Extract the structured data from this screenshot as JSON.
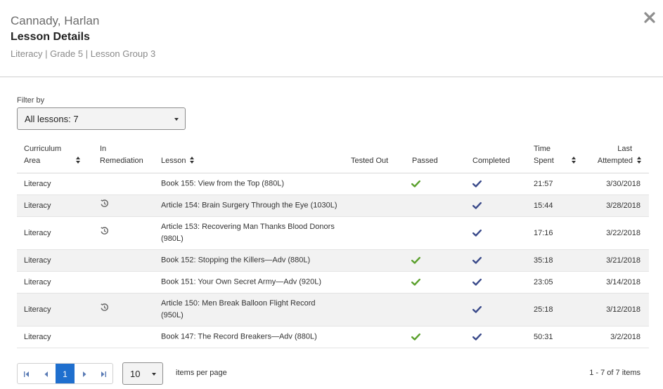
{
  "header": {
    "student_name": "Cannady, Harlan",
    "title": "Lesson Details",
    "breadcrumb": "Literacy | Grade 5 | Lesson Group 3",
    "close_icon": "close-icon"
  },
  "filter": {
    "label": "Filter by",
    "selected": "All lessons: 7"
  },
  "table": {
    "columns": {
      "curriculum_area": "Curriculum Area",
      "curriculum_area_l1": "Curriculum",
      "curriculum_area_l2": "Area",
      "in_remediation_l1": "In",
      "in_remediation_l2": "Remediation",
      "lesson": "Lesson",
      "tested_out": "Tested Out",
      "passed": "Passed",
      "completed": "Completed",
      "time_spent_l1": "Time",
      "time_spent_l2": "Spent",
      "last_attempted_l1": "Last",
      "last_attempted_l2": "Attempted"
    },
    "rows": [
      {
        "area": "Literacy",
        "remediation": false,
        "lesson_l1": "Book 155: View from the Top (880L)",
        "lesson_l2": "",
        "passed": true,
        "completed": true,
        "time": "21:57",
        "last": "3/30/2018"
      },
      {
        "area": "Literacy",
        "remediation": true,
        "lesson_l1": "Article 154: Brain Surgery Through the Eye (1030L)",
        "lesson_l2": "",
        "passed": false,
        "completed": true,
        "time": "15:44",
        "last": "3/28/2018"
      },
      {
        "area": "Literacy",
        "remediation": true,
        "lesson_l1": "Article 153: Recovering Man Thanks Blood Donors",
        "lesson_l2": "(980L)",
        "passed": false,
        "completed": true,
        "time": "17:16",
        "last": "3/22/2018"
      },
      {
        "area": "Literacy",
        "remediation": false,
        "lesson_l1": "Book 152: Stopping the Killers—Adv (880L)",
        "lesson_l2": "",
        "passed": true,
        "completed": true,
        "time": "35:18",
        "last": "3/21/2018"
      },
      {
        "area": "Literacy",
        "remediation": false,
        "lesson_l1": "Book 151: Your Own Secret Army—Adv (920L)",
        "lesson_l2": "",
        "passed": true,
        "completed": true,
        "time": "23:05",
        "last": "3/14/2018"
      },
      {
        "area": "Literacy",
        "remediation": true,
        "lesson_l1": "Article 150: Men Break Balloon Flight Record",
        "lesson_l2": "(950L)",
        "passed": false,
        "completed": true,
        "time": "25:18",
        "last": "3/12/2018"
      },
      {
        "area": "Literacy",
        "remediation": false,
        "lesson_l1": "Book 147: The Record Breakers—Adv (880L)",
        "lesson_l2": "",
        "passed": true,
        "completed": true,
        "time": "50:31",
        "last": "3/2/2018"
      }
    ]
  },
  "pager": {
    "current_page": "1",
    "first_icon": "first-page-icon",
    "prev_icon": "previous-page-icon",
    "next_icon": "next-page-icon",
    "last_icon": "last-page-icon",
    "page_size": "10",
    "page_size_label": "items per page",
    "summary": "1 - 7 of 7 items"
  },
  "colors": {
    "passed_check": "#5aa02c",
    "completed_check": "#3a4a8a",
    "remediation_icon": "#666666",
    "current_page_bg": "#1f6fce",
    "pager_arrow": "#5a7bb5"
  }
}
